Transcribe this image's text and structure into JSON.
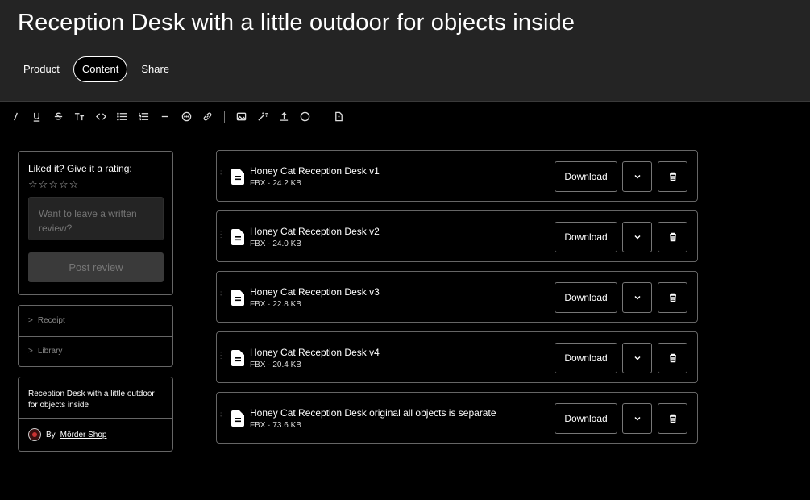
{
  "header": {
    "title": "Reception Desk with a little outdoor for objects inside",
    "tabs": [
      {
        "label": "Product",
        "active": false
      },
      {
        "label": "Content",
        "active": true
      },
      {
        "label": "Share",
        "active": false
      }
    ]
  },
  "toolbar": {
    "tools": [
      {
        "icon": "italic-icon",
        "glyph": "I"
      },
      {
        "icon": "underline-icon",
        "glyph": "U"
      },
      {
        "icon": "strikethrough-icon",
        "glyph": "S"
      },
      {
        "icon": "text-size-icon",
        "glyph": "TT"
      },
      {
        "icon": "code-icon",
        "glyph": "<>"
      },
      {
        "icon": "bullet-list-icon",
        "glyph": "list"
      },
      {
        "icon": "numbered-list-icon",
        "glyph": "list"
      },
      {
        "icon": "horizontal-rule-icon",
        "glyph": "—"
      },
      {
        "icon": "embed-icon",
        "glyph": "..."
      },
      {
        "icon": "link-icon",
        "glyph": "link"
      },
      {
        "icon": "image-icon",
        "glyph": "img"
      },
      {
        "icon": "magic-icon",
        "glyph": "magic"
      },
      {
        "icon": "upload-icon",
        "glyph": "up"
      },
      {
        "icon": "circle-icon",
        "glyph": "o"
      },
      {
        "icon": "file-embed-icon",
        "glyph": "file"
      }
    ]
  },
  "sidebar": {
    "rating": {
      "title": "Liked it? Give it a rating:",
      "stars": [
        "☆",
        "☆",
        "☆",
        "☆",
        "☆"
      ],
      "review_placeholder": "Want to leave a written review?",
      "post_label": "Post review"
    },
    "accordion": [
      {
        "chevron": ">",
        "label": "Receipt"
      },
      {
        "chevron": ">",
        "label": "Library"
      }
    ],
    "product": {
      "name": "Reception Desk with a little outdoor for objects inside",
      "by_label": "By",
      "creator": "Mörder Shop"
    }
  },
  "files": [
    {
      "name": "Honey Cat Reception Desk v1",
      "meta": "FBX · 24.2 KB",
      "download_label": "Download"
    },
    {
      "name": "Honey Cat Reception Desk v2",
      "meta": "FBX · 24.0 KB",
      "download_label": "Download"
    },
    {
      "name": "Honey Cat Reception Desk v3",
      "meta": "FBX · 22.8 KB",
      "download_label": "Download"
    },
    {
      "name": "Honey Cat Reception Desk v4",
      "meta": "FBX · 20.4 KB",
      "download_label": "Download"
    },
    {
      "name": "Honey Cat Reception Desk original all objects is separate",
      "meta": "FBX · 73.6 KB",
      "download_label": "Download"
    }
  ]
}
